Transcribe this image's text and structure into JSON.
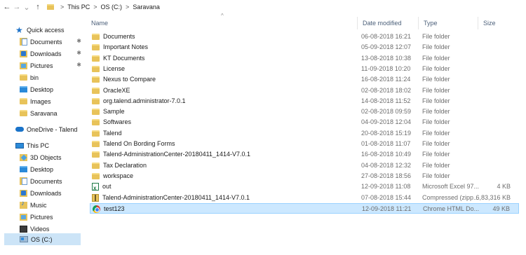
{
  "address": {
    "crumbs": [
      "This PC",
      "OS (C:)",
      "Saravana"
    ]
  },
  "columns": {
    "name": "Name",
    "date": "Date modified",
    "type": "Type",
    "size": "Size"
  },
  "sidebar": {
    "items": [
      {
        "label": "Quick access",
        "icon": "star-icon"
      },
      {
        "label": "Documents",
        "icon": "documents-folder-icon",
        "pinned": true
      },
      {
        "label": "Downloads",
        "icon": "downloads-folder-icon",
        "pinned": true
      },
      {
        "label": "Pictures",
        "icon": "pictures-folder-icon",
        "pinned": true
      },
      {
        "label": "bin",
        "icon": "folder-icon"
      },
      {
        "label": "Desktop",
        "icon": "desktop-folder-icon"
      },
      {
        "label": "Images",
        "icon": "folder-icon"
      },
      {
        "label": "Saravana",
        "icon": "folder-icon"
      },
      {
        "label": "OneDrive - Talend",
        "icon": "onedrive-icon"
      },
      {
        "label": "This PC",
        "icon": "this-pc-icon"
      },
      {
        "label": "3D Objects",
        "icon": "3d-objects-icon"
      },
      {
        "label": "Desktop",
        "icon": "desktop-folder-icon"
      },
      {
        "label": "Documents",
        "icon": "documents-folder-icon"
      },
      {
        "label": "Downloads",
        "icon": "downloads-folder-icon"
      },
      {
        "label": "Music",
        "icon": "music-folder-icon"
      },
      {
        "label": "Pictures",
        "icon": "pictures-folder-icon"
      },
      {
        "label": "Videos",
        "icon": "videos-folder-icon"
      },
      {
        "label": "OS (C:)",
        "icon": "drive-icon",
        "selected": true
      }
    ]
  },
  "files": [
    {
      "name": "Documents",
      "date": "06-08-2018 16:21",
      "type": "File folder",
      "size": "",
      "icon": "folder-icon"
    },
    {
      "name": "Important Notes",
      "date": "05-09-2018 12:07",
      "type": "File folder",
      "size": "",
      "icon": "folder-icon"
    },
    {
      "name": "KT Documents",
      "date": "13-08-2018 10:38",
      "type": "File folder",
      "size": "",
      "icon": "folder-icon"
    },
    {
      "name": "License",
      "date": "11-09-2018 10:20",
      "type": "File folder",
      "size": "",
      "icon": "folder-icon"
    },
    {
      "name": "Nexus to Compare",
      "date": "16-08-2018 11:24",
      "type": "File folder",
      "size": "",
      "icon": "folder-icon"
    },
    {
      "name": "OracleXE",
      "date": "02-08-2018 18:02",
      "type": "File folder",
      "size": "",
      "icon": "folder-icon"
    },
    {
      "name": "org.talend.administrator-7.0.1",
      "date": "14-08-2018 11:52",
      "type": "File folder",
      "size": "",
      "icon": "folder-icon"
    },
    {
      "name": "Sample",
      "date": "02-08-2018 09:59",
      "type": "File folder",
      "size": "",
      "icon": "folder-icon"
    },
    {
      "name": "Softwares",
      "date": "04-09-2018 12:04",
      "type": "File folder",
      "size": "",
      "icon": "folder-icon"
    },
    {
      "name": "Talend",
      "date": "20-08-2018 15:19",
      "type": "File folder",
      "size": "",
      "icon": "folder-icon"
    },
    {
      "name": "Talend On Bording Forms",
      "date": "01-08-2018 11:07",
      "type": "File folder",
      "size": "",
      "icon": "folder-icon"
    },
    {
      "name": "Talend-AdministrationCenter-20180411_1414-V7.0.1",
      "date": "16-08-2018 10:49",
      "type": "File folder",
      "size": "",
      "icon": "folder-icon"
    },
    {
      "name": "Tax Declaration",
      "date": "04-08-2018 12:32",
      "type": "File folder",
      "size": "",
      "icon": "folder-icon"
    },
    {
      "name": "workspace",
      "date": "27-08-2018 18:56",
      "type": "File folder",
      "size": "",
      "icon": "folder-icon"
    },
    {
      "name": "out",
      "date": "12-09-2018 11:08",
      "type": "Microsoft Excel 97...",
      "size": "4 KB",
      "icon": "excel-file-icon"
    },
    {
      "name": "Talend-AdministrationCenter-20180411_1414-V7.0.1",
      "date": "07-08-2018 15:44",
      "type": "Compressed (zipp...",
      "size": "6,83,316 KB",
      "icon": "zip-file-icon"
    },
    {
      "name": "test123",
      "date": "12-09-2018 11:21",
      "type": "Chrome HTML Do...",
      "size": "49 KB",
      "icon": "chrome-html-file-icon",
      "selected": true
    }
  ]
}
